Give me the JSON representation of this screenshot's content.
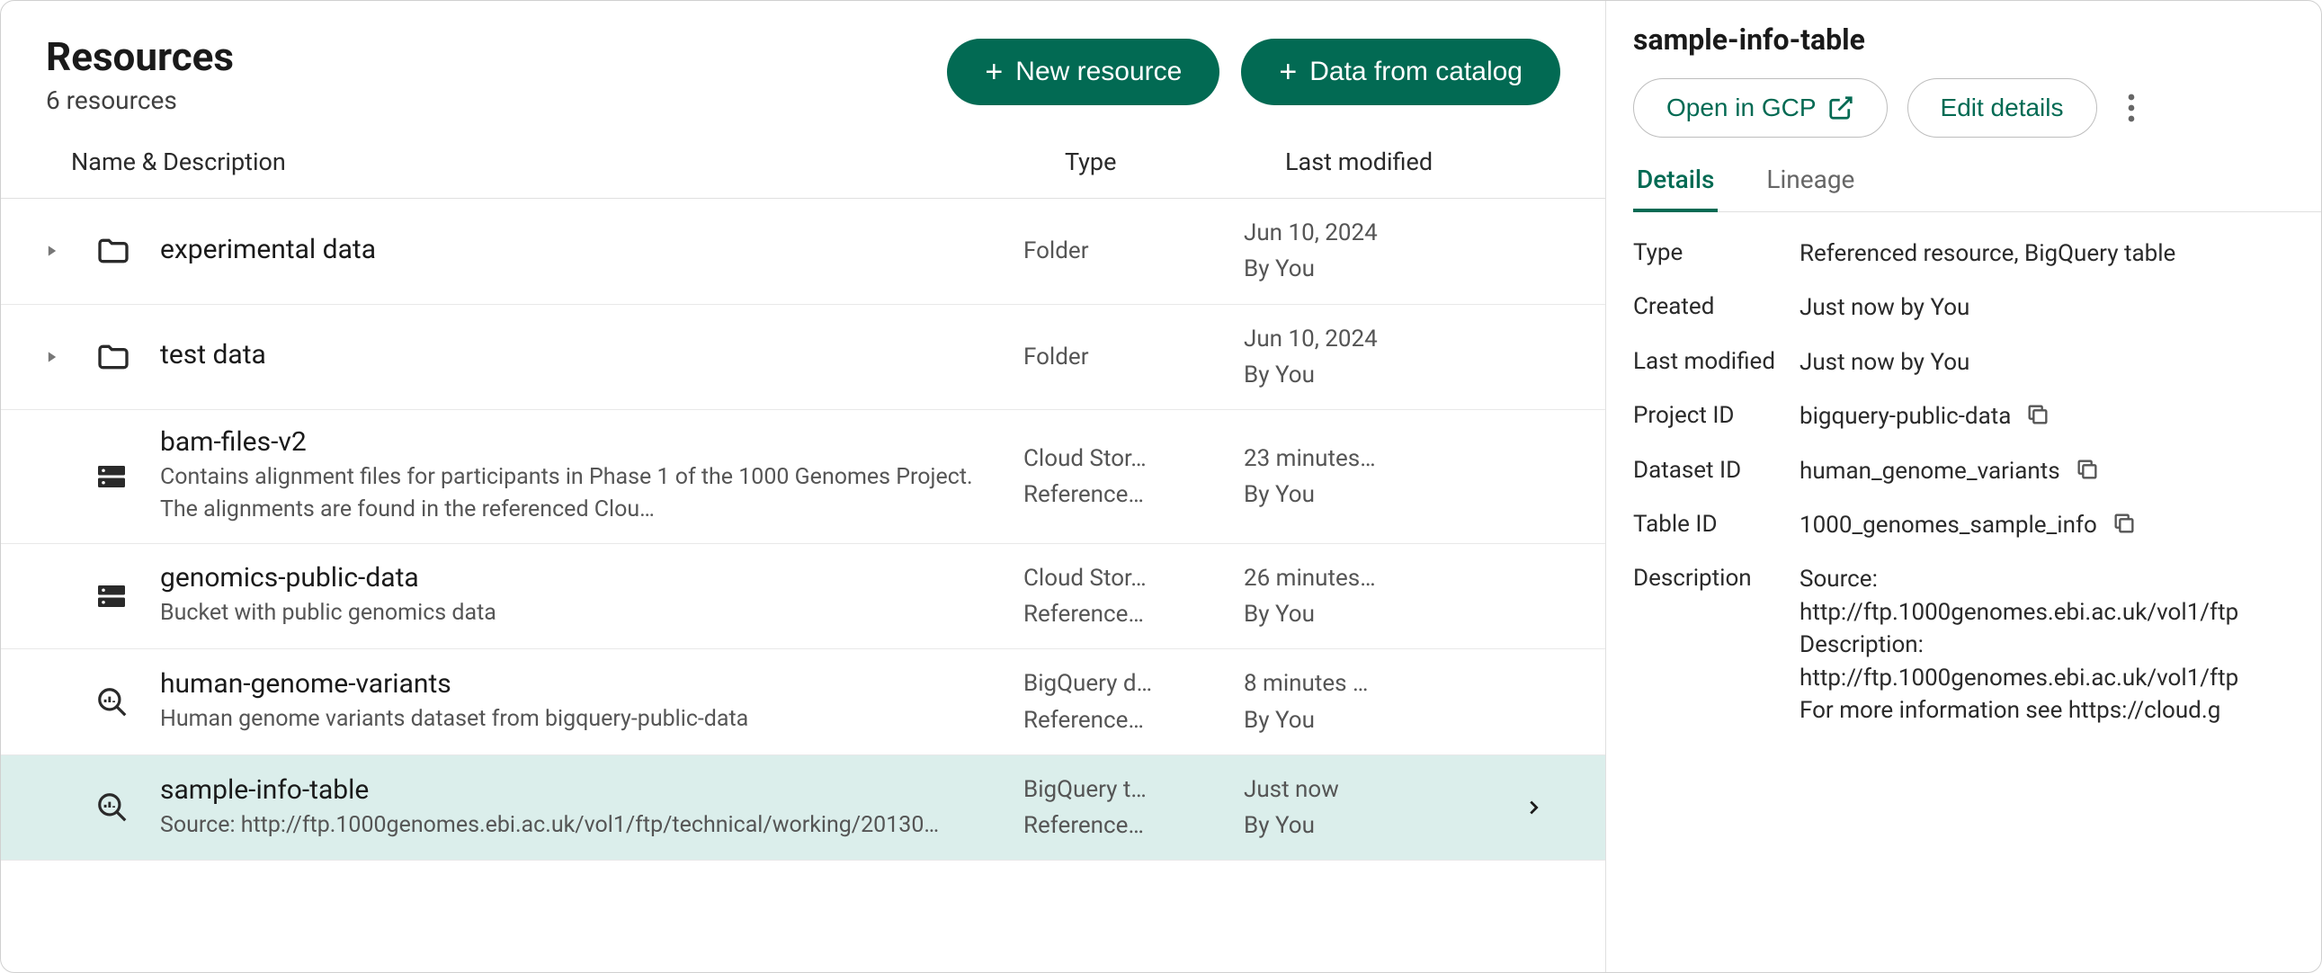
{
  "header": {
    "title": "Resources",
    "subtitle": "6 resources",
    "new_resource_label": "New resource",
    "data_from_catalog_label": "Data from catalog"
  },
  "columns": {
    "name": "Name & Description",
    "type": "Type",
    "modified": "Last modified"
  },
  "rows": [
    {
      "expandable": true,
      "icon": "folder",
      "name": "experimental data",
      "description": "",
      "type_line1": "Folder",
      "type_line2": "",
      "modified_line1": "Jun 10, 2024",
      "modified_line2": "By You",
      "selected": false
    },
    {
      "expandable": true,
      "icon": "folder",
      "name": "test data",
      "description": "",
      "type_line1": "Folder",
      "type_line2": "",
      "modified_line1": "Jun 10, 2024",
      "modified_line2": "By You",
      "selected": false
    },
    {
      "expandable": false,
      "icon": "storage",
      "name": "bam-files-v2",
      "description": "Contains alignment files for participants in Phase 1 of the 1000 Genomes Project. The alignments are found in the referenced Clou…",
      "type_line1": "Cloud Stor…",
      "type_line2": "Reference…",
      "modified_line1": "23 minutes…",
      "modified_line2": "By You",
      "selected": false
    },
    {
      "expandable": false,
      "icon": "storage",
      "name": "genomics-public-data",
      "description": "Bucket with public genomics data",
      "type_line1": "Cloud Stor…",
      "type_line2": "Reference…",
      "modified_line1": "26 minutes…",
      "modified_line2": "By You",
      "selected": false
    },
    {
      "expandable": false,
      "icon": "query",
      "name": "human-genome-variants",
      "description": "Human genome variants dataset from bigquery-public-data",
      "type_line1": "BigQuery d…",
      "type_line2": "Reference…",
      "modified_line1": "8 minutes …",
      "modified_line2": "By You",
      "selected": false
    },
    {
      "expandable": false,
      "icon": "query",
      "name": "sample-info-table",
      "description": "Source: http://ftp.1000genomes.ebi.ac.uk/vol1/ftp/technical/working/20130…",
      "type_line1": "BigQuery t…",
      "type_line2": "Reference…",
      "modified_line1": "Just now",
      "modified_line2": "By You",
      "selected": true
    }
  ],
  "details": {
    "title": "sample-info-table",
    "open_in_gcp_label": "Open in GCP",
    "edit_details_label": "Edit details",
    "tabs": {
      "details": "Details",
      "lineage": "Lineage"
    },
    "fields": [
      {
        "label": "Type",
        "value": "Referenced resource, BigQuery table",
        "copy": false,
        "wrap": false,
        "multiline_label": false
      },
      {
        "label": "Created",
        "value": "Just now by You",
        "copy": false,
        "wrap": false,
        "multiline_label": false
      },
      {
        "label": "Last modified",
        "value": "Just now by You",
        "copy": false,
        "wrap": false,
        "multiline_label": true
      },
      {
        "label": "Project ID",
        "value": "bigquery-public-data",
        "copy": true,
        "wrap": false,
        "multiline_label": false
      },
      {
        "label": "Dataset ID",
        "value": "human_genome_variants",
        "copy": true,
        "wrap": false,
        "multiline_label": false
      },
      {
        "label": "Table ID",
        "value": "1000_genomes_sample_info",
        "copy": true,
        "wrap": false,
        "multiline_label": false
      },
      {
        "label": "Description",
        "value": "Source: http://ftp.1000genomes.ebi.ac.uk/vol1/ftp\nDescription: http://ftp.1000genomes.ebi.ac.uk/vol1/ftp\nFor more information see https://cloud.g",
        "copy": false,
        "wrap": true,
        "multiline_label": false
      }
    ]
  }
}
